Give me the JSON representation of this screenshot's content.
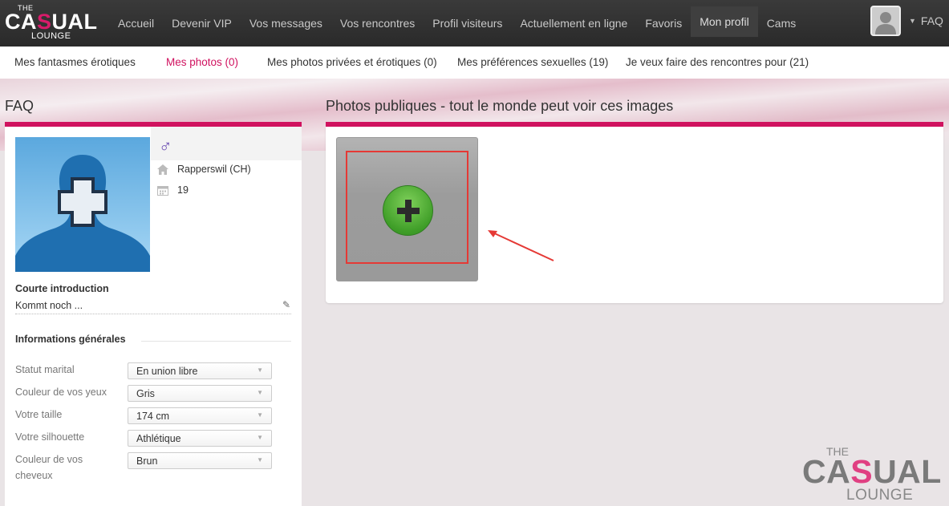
{
  "logo": {
    "the": "THE",
    "casual_pre": "CA",
    "casual_s": "S",
    "casual_post": "UAL",
    "lounge": "LOUNGE"
  },
  "nav": {
    "items": [
      "Accueil",
      "Devenir VIP",
      "Vos messages",
      "Vos rencontres",
      "Profil visiteurs",
      "Actuellement en ligne",
      "Favoris",
      "Mon profil",
      "Cams"
    ],
    "active": "Mon profil",
    "faq": "FAQ"
  },
  "subnav": {
    "tabs": [
      "Mes fantasmes érotiques",
      "Mes photos (0)",
      "Mes photos privées et érotiques (0)",
      "Mes préférences sexuelles (19)",
      "Je veux faire des rencontres pour (21)"
    ],
    "active_index": 1
  },
  "left": {
    "title": "FAQ",
    "location": "Rapperswil (CH)",
    "age": "19",
    "intro_label": "Courte introduction",
    "intro_text": "Kommt noch ...",
    "general_label": "Informations générales",
    "fields": [
      {
        "label": "Statut marital",
        "value": "En union libre"
      },
      {
        "label": "Couleur de vos yeux",
        "value": "Gris"
      },
      {
        "label": "Votre taille",
        "value": "174 cm"
      },
      {
        "label": "Votre silhouette",
        "value": "Athlétique"
      },
      {
        "label": "Couleur de vos cheveux",
        "value": "Brun"
      }
    ]
  },
  "right": {
    "title": "Photos publiques - tout le monde peut voir ces images"
  },
  "colors": {
    "accent": "#d0125f",
    "nav_bg": "#2f2f2f",
    "add_green": "#4caf33",
    "highlight": "#e53935"
  }
}
